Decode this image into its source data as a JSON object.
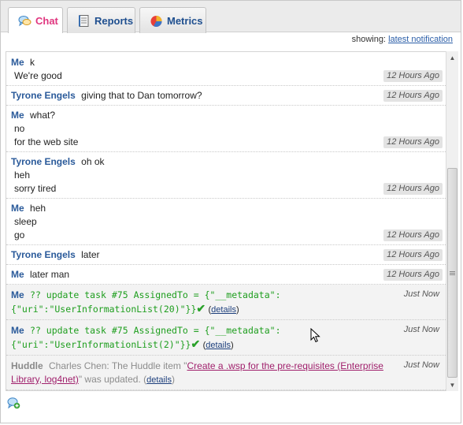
{
  "tabs": [
    {
      "label": "Chat",
      "icon": "chat-bubbles-icon",
      "active": true
    },
    {
      "label": "Reports",
      "icon": "notepad-icon",
      "active": false
    },
    {
      "label": "Metrics",
      "icon": "pie-chart-icon",
      "active": false
    }
  ],
  "showing": {
    "prefix": "showing:",
    "link": "latest notification"
  },
  "messages": [
    {
      "sender": "Me",
      "text": "k",
      "lines": [
        "We're good"
      ],
      "time": "12 Hours Ago"
    },
    {
      "sender": "Tyrone Engels",
      "text": "giving that to Dan tomorrow?",
      "lines": [],
      "time": "12 Hours Ago"
    },
    {
      "sender": "Me",
      "text": "what?",
      "lines": [
        "no",
        "for the web site"
      ],
      "time": "12 Hours Ago"
    },
    {
      "sender": "Tyrone Engels",
      "text": "oh ok",
      "lines": [
        "heh",
        "sorry tired"
      ],
      "time": "12 Hours Ago"
    },
    {
      "sender": "Me",
      "text": "heh",
      "lines": [
        "sleep",
        "go"
      ],
      "time": "12 Hours Ago"
    },
    {
      "sender": "Tyrone Engels",
      "text": "later",
      "lines": [],
      "time": "12 Hours Ago"
    },
    {
      "sender": "Me",
      "text": "later man",
      "lines": [],
      "time": "12 Hours Ago"
    }
  ],
  "commands": [
    {
      "sender": "Me",
      "line1": "?? update task #75 AssignedTo = {\"__metadata\":",
      "line2": "{\"uri\":\"UserInformationList(20)\"}}",
      "details": "details",
      "time": "Just Now"
    },
    {
      "sender": "Me",
      "line1": "?? update task #75 AssignedTo = {\"__metadata\":",
      "line2": "{\"uri\":\"UserInformationList(2)\"}}",
      "details": "details",
      "time": "Just Now"
    }
  ],
  "huddle": {
    "sender": "Huddle",
    "prefix": "Charles Chen: The Huddle item \"",
    "link1": "Create a .wsp for the pre-requisites (Enterprise",
    "link2": "Library, log4net)",
    "suffix": "\" was updated. (",
    "details": "details",
    "close": ")",
    "time": "Just Now"
  },
  "colors": {
    "accent": "#e0367f",
    "sender": "#2a5a9a",
    "command": "#1e9e1e",
    "huddle_link": "#a0206c"
  },
  "bottom_icon": "new-chat-icon"
}
